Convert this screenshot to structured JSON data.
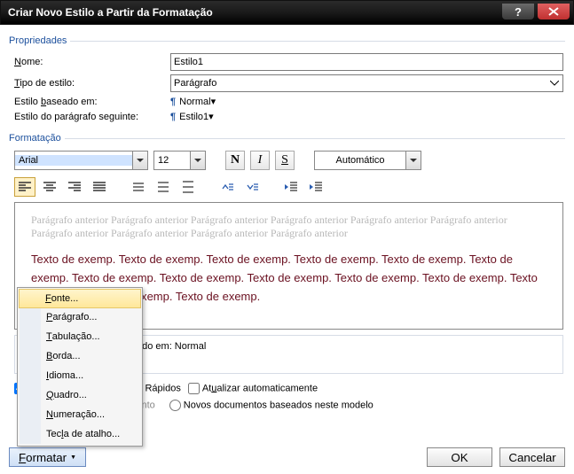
{
  "title": "Criar Novo Estilo a Partir da Formatação",
  "sections": {
    "properties": "Propriedades",
    "formatting": "Formatação"
  },
  "props": {
    "name_label": "Nome:",
    "name_value": "Estilo1",
    "type_label": "Tipo de estilo:",
    "type_value": "Parágrafo",
    "based_label_pre": "Estilo ",
    "based_label_u": "b",
    "based_label_post": "aseado em:",
    "based_value": "Normal",
    "following_label": "Estilo do parágrafo seguinte:",
    "following_value": "Estilo1"
  },
  "formatting": {
    "font": "Arial",
    "size": "12",
    "bold": "N",
    "italic": "I",
    "underline": "S",
    "color_auto": "Automático"
  },
  "preview": {
    "prev_para": "Parágrafo anterior Parágrafo anterior Parágrafo anterior Parágrafo anterior Parágrafo anterior Parágrafo anterior Parágrafo anterior Parágrafo anterior Parágrafo anterior Parágrafo anterior",
    "sample": "Texto de exemp. Texto de exemp. Texto de exemp. Texto de exemp. Texto de exemp. Texto de exemp. Texto de exemp. Texto de exemp. Texto de exemp. Texto de exemp. Texto de exemp. Texto de exemp. Texto de exemp. Texto de exemp."
  },
  "info": {
    "line1": "Estilo: Estilo Rápido, Baseado em: Normal"
  },
  "options": {
    "add_quick_pre": "Adicionar à lista de ",
    "add_quick_u": "E",
    "add_quick_post": "stilos Rápidos",
    "auto_update_pre": "At",
    "auto_update_u": "u",
    "auto_update_post": "alizar automaticamente",
    "only_doc": "Apenas neste documento",
    "new_docs": "Novos documentos baseados neste modelo"
  },
  "format_button": "Formatar",
  "ok": "OK",
  "cancel": "Cancelar",
  "menu": {
    "font_pre": "",
    "font_u": "F",
    "font_post": "onte...",
    "para_pre": "",
    "para_u": "P",
    "para_post": "arágrafo...",
    "tab_pre": "",
    "tab_u": "T",
    "tab_post": "abulação...",
    "border_pre": "",
    "border_u": "B",
    "border_post": "orda...",
    "lang_pre": "",
    "lang_u": "I",
    "lang_post": "dioma...",
    "frame_pre": "",
    "frame_u": "Q",
    "frame_post": "uadro...",
    "num_pre": "",
    "num_u": "N",
    "num_post": "umeração...",
    "key_pre": "Tec",
    "key_u": "l",
    "key_post": "a de atalho..."
  }
}
